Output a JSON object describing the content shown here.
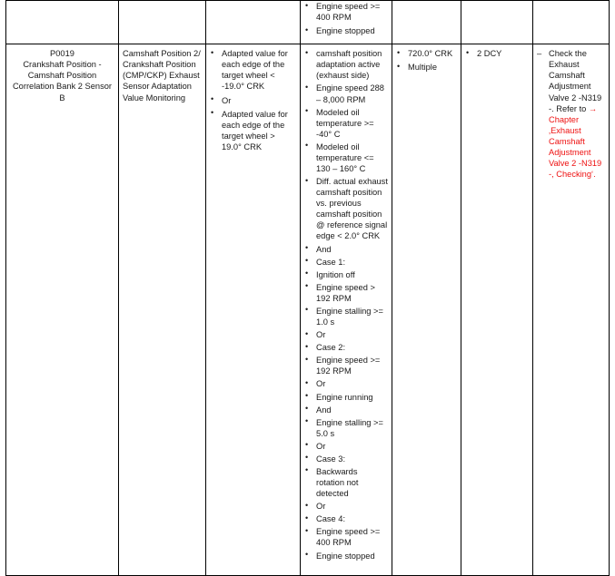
{
  "document": {
    "type": "dtc-fault-table",
    "page_background": "#ffffff",
    "text_color": "#1a1a1a",
    "link_color": "#ee1111"
  },
  "table": {
    "columns": [
      "dtc-code-description",
      "function-monitored",
      "malfunction-criteria-threshold",
      "secondary-parameters-enable-conditions",
      "monitoring-time-length",
      "mil-illumination",
      "repair-instruction"
    ],
    "rows": [
      {
        "id": "row-previous-continued",
        "cells": {
          "dtc": "",
          "function": "",
          "criteria": "",
          "conditions": [
            "Engine speed >= 400 RPM",
            "Engine stopped"
          ],
          "time": "",
          "mil": "",
          "repair": ""
        }
      },
      {
        "id": "row-p0019",
        "cells": {
          "dtc": "P0019\nCrankshaft Position - Camshaft Position Correlation Bank 2 Sensor B",
          "function": "Camshaft Position 2/ Crankshaft Position (CMP/CKP) Exhaust Sensor Adaptation Value Monitoring",
          "criteria": [
            "Adapted value for each edge of the target wheel < -19.0° CRK",
            "Or",
            "Adapted value for each edge of the target wheel > 19.0° CRK"
          ],
          "conditions": [
            "camshaft position adaptation active (exhaust side)",
            "Engine speed 288 – 8,000 RPM",
            "Modeled oil temperature >= -40° C",
            "Modeled oil temperature <= 130 – 160° C",
            "Diff. actual exhaust camshaft position vs. previous camshaft position @ reference signal edge < 2.0° CRK",
            "And",
            "Case 1:",
            "Ignition off",
            "Engine speed > 192 RPM",
            "Engine stalling >= 1.0 s",
            "Or",
            "Case 2:",
            "Engine speed >= 192 RPM",
            "Or",
            "Engine running",
            "And",
            "Engine stalling >= 5.0 s",
            "Or",
            "Case 3:",
            "Backwards rotation not detected",
            "Or",
            "Case 4:",
            "Engine speed >= 400 RPM",
            "Engine stopped"
          ],
          "time": [
            "720.0° CRK",
            "Multiple"
          ],
          "mil": [
            "2 DCY"
          ],
          "repair": {
            "lead": "Check the Exhaust Camshaft Adjustment Valve 2 -N319 -. Refer to ",
            "link": "→ Chapter ‚Exhaust Camshaft Adjustment Valve 2 -N319 -, Checking‘."
          }
        }
      }
    ]
  }
}
